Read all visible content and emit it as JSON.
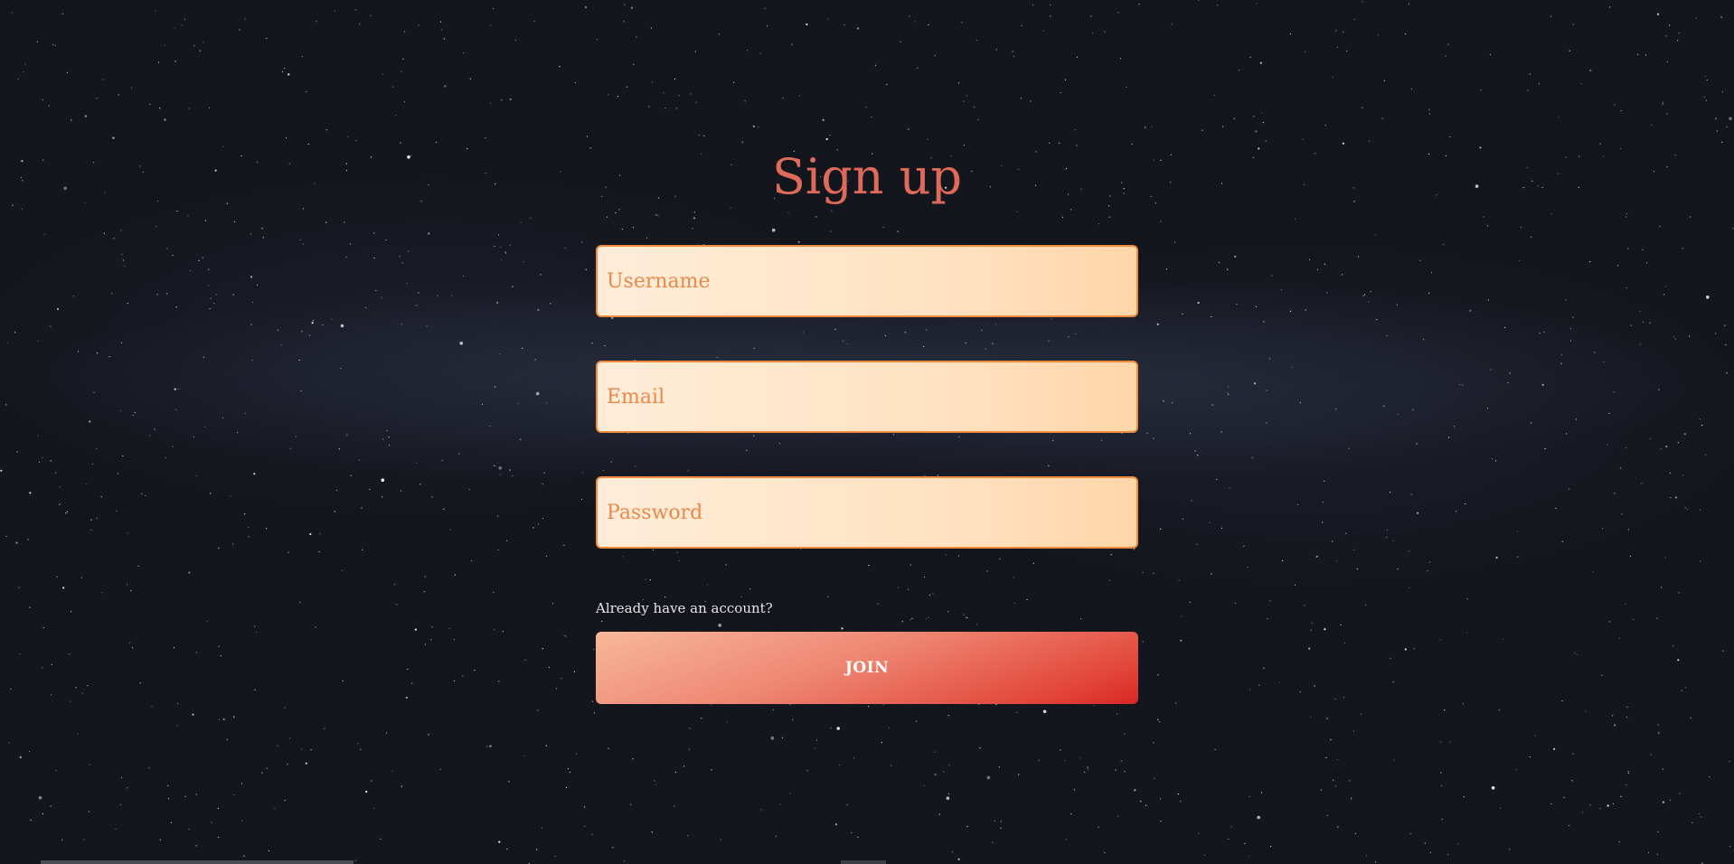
{
  "title": "Sign up",
  "fields": {
    "username_placeholder": "Username",
    "email_placeholder": "Email",
    "password_placeholder": "Password"
  },
  "signin_link": "Already have an account?",
  "join_button": "JOIN",
  "colors": {
    "title": "#e06a5a",
    "field_border": "#f08a3c",
    "field_background": "#ffe3c4",
    "placeholder": "#e8894a",
    "button_start": "#f7b89a",
    "button_end": "#d92626",
    "background": "#14161d"
  }
}
